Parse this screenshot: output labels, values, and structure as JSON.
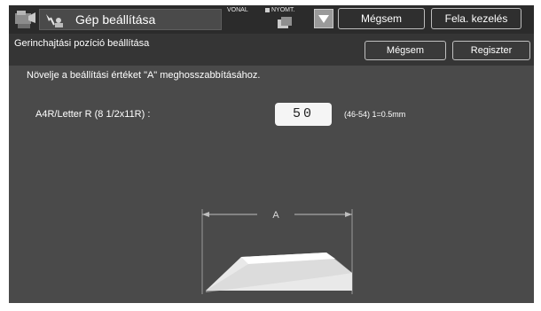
{
  "header": {
    "title": "Gép beállítása",
    "indicators": {
      "line": "VONAL",
      "print": "NYOMT."
    },
    "cancel_button": "Mégsem",
    "release_button": "Fela. kezelés"
  },
  "subheader": {
    "title": "Gerinchajtási pozíció beállítása",
    "cancel_button": "Mégsem",
    "register_button": "Regiszter"
  },
  "content": {
    "instruction": "Növelje a beállítási értéket \"A\" meghosszabbításához.",
    "setting": {
      "label": "A4R/Letter R (8 1/2x11R) :",
      "value": "50",
      "range": "(46-54) 1=0.5mm"
    },
    "diagram": {
      "dimension_label": "A"
    }
  },
  "colors": {
    "screen_bg": "#4a4a4a",
    "topbar_bg": "#2b2b2b",
    "subbar_bg": "#353535",
    "value_box_bg": "#f5f5f5"
  }
}
